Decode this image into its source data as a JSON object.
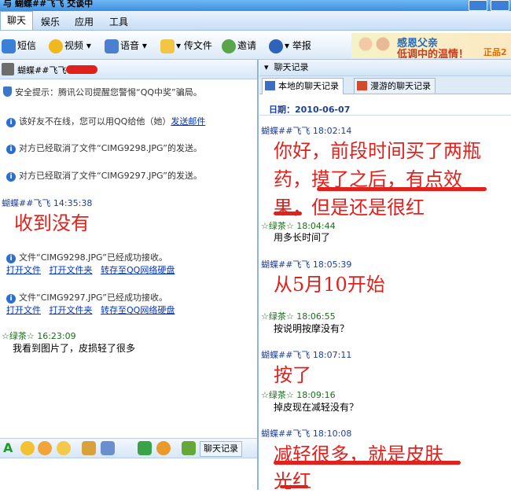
{
  "window": {
    "title": "与 蝴蝶##飞飞 交谈中"
  },
  "menubar": {
    "items": [
      "聊天",
      "娱乐",
      "应用",
      "工具"
    ]
  },
  "toolbar": {
    "items": [
      "短信",
      "视频",
      "语音",
      "传文件",
      "邀请",
      "举报"
    ]
  },
  "ad": {
    "line1": "感恩父亲",
    "line2": "低调中的温情！",
    "line3": "正品2"
  },
  "left": {
    "contact_name": "蝴蝶##飞飞",
    "security_tip": "安全提示：腾讯公司提醒您警惕“QQ中奖”骗局。",
    "offline_notice": "该好友不在线，您可以用QQ给他（她）",
    "offline_link": "发送邮件",
    "cancel1": "对方已经取消了文件“CIMG9298.JPG”的发送。",
    "cancel2": "对方已经取消了文件“CIMG9297.JPG”的发送。",
    "msg1_sender": "蝴蝶##飞飞 14:35:38",
    "msg1_text": "收到没有",
    "recv1": "文件“CIMG9298.JPG”已经成功接收。",
    "recv2": "文件“CIMG9297.JPG”已经成功接收。",
    "links": [
      "打开文件",
      "打开文件夹",
      "转存至QQ网络硬盘"
    ],
    "msg2_sender": "☆绿茶☆ 16:23:09",
    "msg2_text": "我看到图片了，皮损轻了很多",
    "history_button": "聊天记录"
  },
  "right": {
    "header": "聊天记录",
    "tabs": [
      "本地的聊天记录",
      "漫游的聊天记录"
    ],
    "date_label": "日期：2010-06-07",
    "messages": [
      {
        "sender": "蝴蝶##飞飞 18:02:14",
        "line1": "你好，前段时间买了两瓶",
        "line2": "药，摸了之后，有点效",
        "line3": "果，但是还是很红"
      },
      {
        "sender": "☆绿茶☆ 18:04:44",
        "text": "用多长时间了"
      },
      {
        "sender": "蝴蝶##飞飞 18:05:39",
        "text": "从5月10开始"
      },
      {
        "sender": "☆绿茶☆ 18:06:55",
        "text": "按说明按摩没有？"
      },
      {
        "sender": "蝴蝶##飞飞 18:07:11",
        "text": "按了"
      },
      {
        "sender": "☆绿茶☆ 18:09:16",
        "text": "掉皮现在减轻没有？"
      },
      {
        "sender": "蝴蝶##飞飞 18:10:08",
        "line1": "减轻很多，就是皮肤",
        "line2": "光红"
      }
    ]
  }
}
